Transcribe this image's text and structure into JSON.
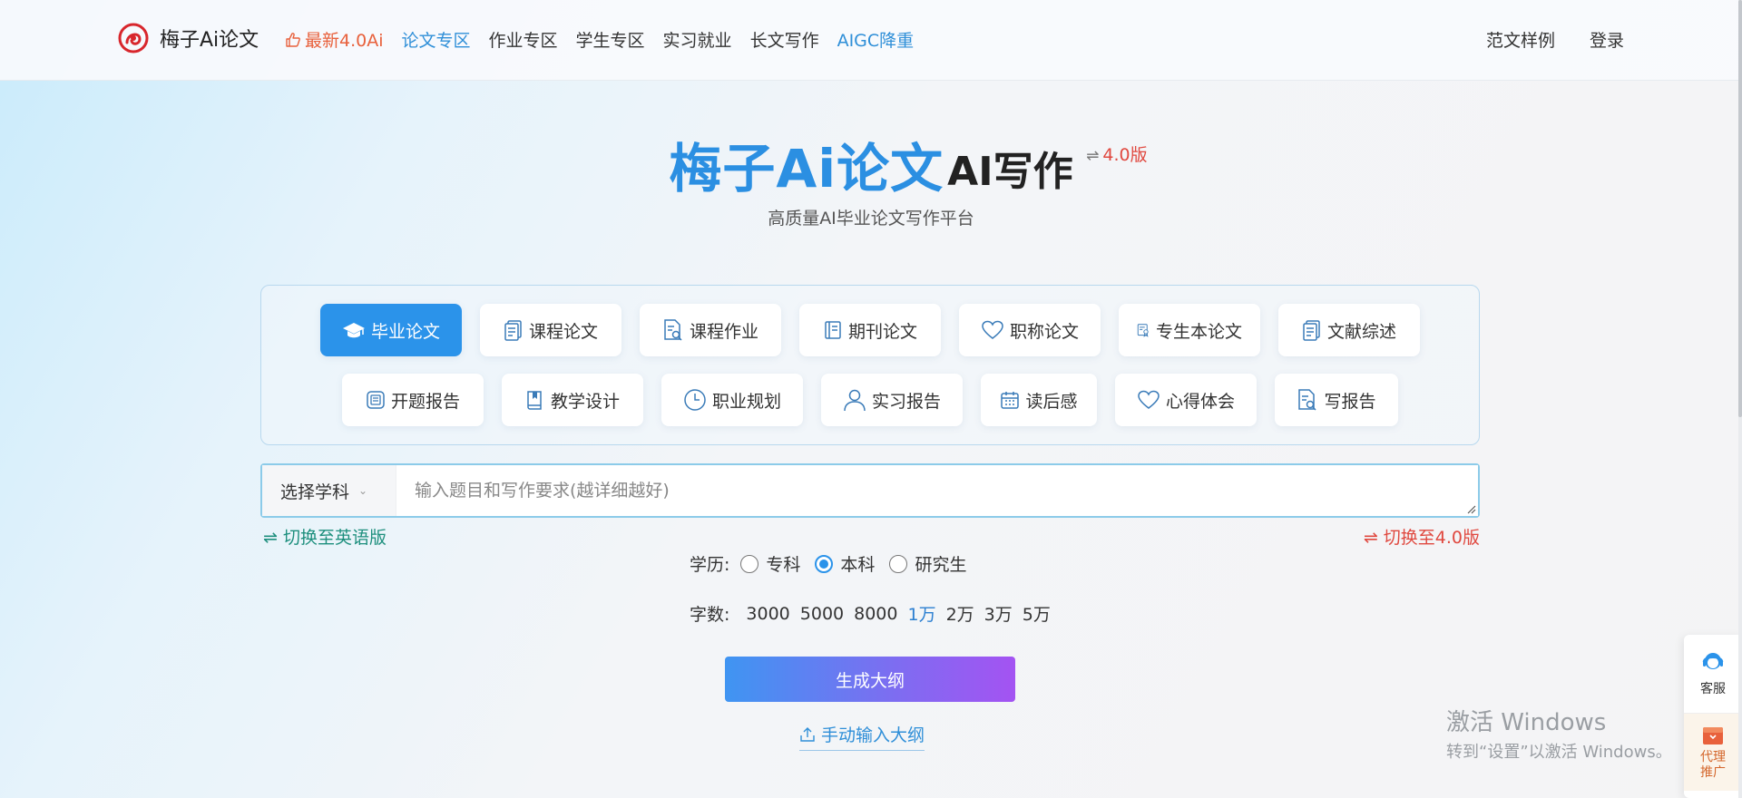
{
  "nav": {
    "logo_text": "梅子Ai论文",
    "links": [
      {
        "label": "最新4.0Ai",
        "style": "hot"
      },
      {
        "label": "论文专区",
        "style": "active"
      },
      {
        "label": "作业专区",
        "style": ""
      },
      {
        "label": "学生专区",
        "style": ""
      },
      {
        "label": "实习就业",
        "style": ""
      },
      {
        "label": "长文写作",
        "style": ""
      },
      {
        "label": "AIGC降重",
        "style": "blue"
      }
    ],
    "right": [
      "范文样例",
      "登录"
    ]
  },
  "hero": {
    "brand": "梅子Ai论文",
    "ai_writing": "AI写作",
    "version_icon": "⇌",
    "version": "4.0版",
    "subtitle": "高质量AI毕业论文写作平台"
  },
  "categories": {
    "row1": [
      {
        "label": "毕业论文",
        "icon": "graduation-cap-icon",
        "active": true
      },
      {
        "label": "课程论文",
        "icon": "document-icon",
        "active": false
      },
      {
        "label": "课程作业",
        "icon": "document-search-icon",
        "active": false
      },
      {
        "label": "期刊论文",
        "icon": "book-icon",
        "active": false
      },
      {
        "label": "职称论文",
        "icon": "heart-icon",
        "active": false
      },
      {
        "label": "专生本论文",
        "icon": "certificate-icon",
        "active": false
      },
      {
        "label": "文献综述",
        "icon": "document-icon",
        "active": false
      }
    ],
    "row2": [
      {
        "label": "开题报告",
        "icon": "report-icon",
        "active": false
      },
      {
        "label": "教学设计",
        "icon": "book-icon",
        "active": false
      },
      {
        "label": "职业规划",
        "icon": "clock-icon",
        "active": false
      },
      {
        "label": "实习报告",
        "icon": "user-icon",
        "active": false
      },
      {
        "label": "读后感",
        "icon": "calendar-icon",
        "active": false
      },
      {
        "label": "心得体会",
        "icon": "heart-icon",
        "active": false
      },
      {
        "label": "写报告",
        "icon": "document-search-icon",
        "active": false
      }
    ]
  },
  "input": {
    "subject_label": "选择学科",
    "placeholder": "输入题目和写作要求(越详细越好)",
    "value": ""
  },
  "switch_english": "⇌ 切换至英语版",
  "switch_v4": "⇌ 切换至4.0版",
  "education": {
    "label": "学历:",
    "options": [
      {
        "label": "专科",
        "checked": false
      },
      {
        "label": "本科",
        "checked": true
      },
      {
        "label": "研究生",
        "checked": false
      }
    ]
  },
  "word_count": {
    "label": "字数:",
    "options": [
      "3000",
      "5000",
      "8000",
      "1万",
      "2万",
      "3万",
      "5万"
    ],
    "selected": "1万"
  },
  "generate_button": "生成大纲",
  "manual_outline": "手动输入大纲",
  "watermark": {
    "line1": "激活 Windows",
    "line2": "转到“设置”以激活 Windows。"
  },
  "side_float": {
    "service": "客服",
    "agent": "代理推广"
  },
  "colors": {
    "brand_blue": "#2b8fe2",
    "hot": "#e8613c",
    "version_red": "#e0483f",
    "switch_green": "#1d8f7d"
  }
}
